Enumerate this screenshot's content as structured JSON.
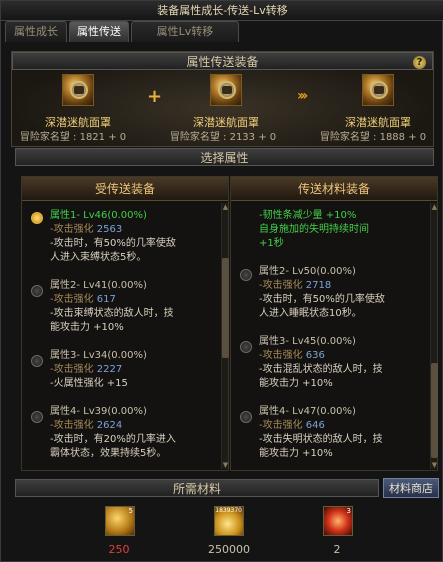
{
  "window": {
    "title": "装备属性成长-传送-Lv转移"
  },
  "tabs": [
    {
      "label": "属性成长",
      "active": false
    },
    {
      "label": "属性传送",
      "active": true
    },
    {
      "label": "属性Lv转移",
      "active": false
    }
  ],
  "transfer": {
    "header": "属性传送装备",
    "help_label": "?",
    "items": [
      {
        "name": "深潜迷航面罩",
        "reputation": "冒险家名望 : 1821 + 0"
      },
      {
        "name": "深潜迷航面罩",
        "reputation": "冒险家名望 : 2133 + 0"
      },
      {
        "name": "深潜迷航面罩",
        "reputation": "冒险家名望 : 1888 + 0"
      }
    ]
  },
  "select": {
    "header": "选择属性",
    "receiver": {
      "title": "受传送装备",
      "attributes": [
        {
          "title": "属性1- Lv46(0.00%)",
          "selected": true,
          "lines": [
            {
              "t": "-攻击强化 ",
              "v": "2563"
            },
            {
              "t": "-攻击时，有50%的几率使敌"
            },
            {
              "t": " 人进入束缚状态5秒。"
            }
          ]
        },
        {
          "title": "属性2- Lv41(0.00%)",
          "selected": false,
          "lines": [
            {
              "t": "-攻击强化 ",
              "v": "617"
            },
            {
              "t": "-攻击束缚状态的敌人时，技"
            },
            {
              "t": " 能攻击力 +10%"
            }
          ]
        },
        {
          "title": "属性3- Lv34(0.00%)",
          "selected": false,
          "lines": [
            {
              "t": "-攻击强化 ",
              "v": "2227"
            },
            {
              "t": "-火属性强化 +15"
            }
          ]
        },
        {
          "title": "属性4- Lv39(0.00%)",
          "selected": false,
          "lines": [
            {
              "t": "-攻击强化 ",
              "v": "2624"
            },
            {
              "t": "-攻击时，有20%的几率进入"
            },
            {
              "t": " 霸体状态，效果持续5秒。"
            }
          ]
        }
      ]
    },
    "source": {
      "title": "传送材料装备",
      "top_lines": [
        "-韧性条减少量 +10%",
        " 自身施加的失明持续时间",
        " +1秒"
      ],
      "attributes": [
        {
          "title": "属性2- Lv50(0.00%)",
          "selected": false,
          "lines": [
            {
              "t": "-攻击强化 ",
              "v": "2718"
            },
            {
              "t": "-攻击时，有50%的几率使敌"
            },
            {
              "t": " 人进入睡眠状态10秒。"
            }
          ]
        },
        {
          "title": "属性3- Lv45(0.00%)",
          "selected": false,
          "lines": [
            {
              "t": "-攻击强化 ",
              "v": "636"
            },
            {
              "t": "-攻击混乱状态的敌人时，技"
            },
            {
              "t": " 能攻击力 +10%"
            }
          ]
        },
        {
          "title": "属性4- Lv47(0.00%)",
          "selected": false,
          "lines": [
            {
              "t": "-攻击强化 ",
              "v": "646"
            },
            {
              "t": "-攻击失明状态的敌人时，技"
            },
            {
              "t": " 能攻击力 +10%"
            }
          ]
        }
      ]
    }
  },
  "materials": {
    "header": "所需材料",
    "shop_label": "材料商店",
    "items": [
      {
        "icon": "gold-ticket-icon",
        "badge": "5",
        "count": "250",
        "count_color": "#e04040"
      },
      {
        "icon": "gold-coins-icon",
        "badge": "1839370",
        "count": "250000",
        "count_color": "#c8c0ac"
      },
      {
        "icon": "red-crystal-icon",
        "badge": "3",
        "count": "2",
        "count_color": "#c8c0ac"
      }
    ]
  }
}
